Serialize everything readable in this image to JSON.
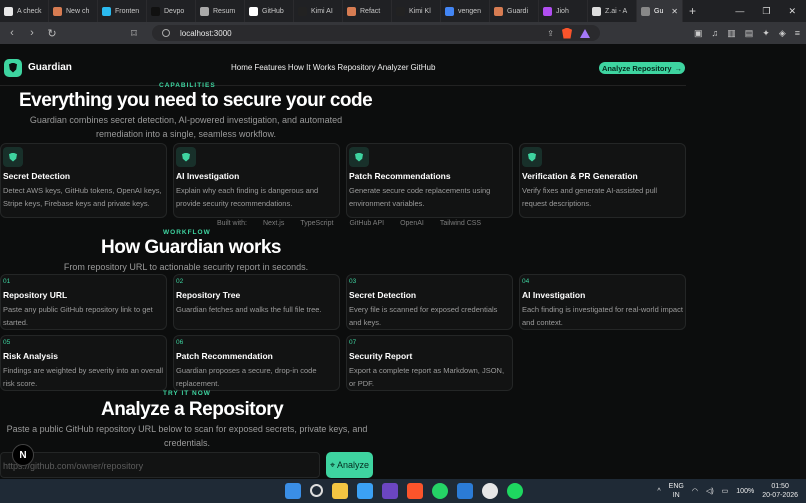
{
  "browser": {
    "tabs": [
      {
        "label": "A check",
        "color": "#e8e8e8"
      },
      {
        "label": "New ch",
        "color": "#d77c52"
      },
      {
        "label": "Fronten",
        "color": "#2bbbf0"
      },
      {
        "label": "Devpo",
        "color": "#111111"
      },
      {
        "label": "Resum",
        "color": "#aaaaaa"
      },
      {
        "label": "GitHub",
        "color": "#ffffff"
      },
      {
        "label": "Kimi AI",
        "color": "#222222"
      },
      {
        "label": "Refact",
        "color": "#d77c52"
      },
      {
        "label": "Kimi Kl",
        "color": "#222222"
      },
      {
        "label": "vengen",
        "color": "#4285f4"
      },
      {
        "label": "Guardi",
        "color": "#d77c52"
      },
      {
        "label": "Jioh",
        "color": "#b04ef0"
      },
      {
        "label": "Z.ai - A",
        "color": "#dddddd"
      },
      {
        "label": "Gu",
        "color": "#888888",
        "active": true
      }
    ],
    "url": "localhost:3000"
  },
  "site": {
    "brand": "Guardian",
    "nav": [
      "Home",
      "Features",
      "How It Works",
      "Repository Analyzer",
      "GitHub"
    ],
    "cta": "Analyze Repository",
    "cta_arrow": "→"
  },
  "capabilities": {
    "eyebrow": "CAPABILITIES",
    "title": "Everything you need to secure your code",
    "subtitle": "Guardian combines secret detection, AI-powered investigation, and automated remediation into a single, seamless workflow.",
    "cards": [
      {
        "title": "Secret Detection",
        "desc": "Detect AWS keys, GitHub tokens, OpenAI keys, Stripe keys, Firebase keys and private keys."
      },
      {
        "title": "AI Investigation",
        "desc": "Explain why each finding is dangerous and provide security recommendations."
      },
      {
        "title": "Patch Recommendations",
        "desc": "Generate secure code replacements using environment variables."
      },
      {
        "title": "Verification & PR Generation",
        "desc": "Verify fixes and generate AI-assisted pull request descriptions."
      }
    ]
  },
  "built_with": {
    "label": "Built with:",
    "items": [
      "Next.js",
      "TypeScript",
      "GitHub API",
      "OpenAI",
      "Tailwind CSS"
    ]
  },
  "workflow": {
    "eyebrow": "WORKFLOW",
    "title": "How Guardian works",
    "subtitle": "From repository URL to actionable security report in seconds.",
    "steps": [
      {
        "num": "01",
        "title": "Repository URL",
        "desc": "Paste any public GitHub repository link to get started."
      },
      {
        "num": "02",
        "title": "Repository Tree",
        "desc": "Guardian fetches and walks the full file tree."
      },
      {
        "num": "03",
        "title": "Secret Detection",
        "desc": "Every file is scanned for exposed credentials and keys."
      },
      {
        "num": "04",
        "title": "AI Investigation",
        "desc": "Each finding is investigated for real-world impact and context."
      },
      {
        "num": "05",
        "title": "Risk Analysis",
        "desc": "Findings are weighted by severity into an overall risk score."
      },
      {
        "num": "06",
        "title": "Patch Recommendation",
        "desc": "Guardian proposes a secure, drop-in code replacement."
      },
      {
        "num": "07",
        "title": "Security Report",
        "desc": "Export a complete report as Markdown, JSON, or PDF."
      }
    ]
  },
  "try": {
    "eyebrow": "TRY IT NOW",
    "title": "Analyze a Repository",
    "subtitle": "Paste a public GitHub repository URL below to scan for exposed secrets, private keys, and credentials.",
    "placeholder": "https://github.com/owner/repository",
    "button": "Analyze"
  },
  "taskbar": {
    "lang_top": "ENG",
    "lang_bottom": "IN",
    "battery": "100%",
    "time": "01:50",
    "date": "20-07-2026"
  }
}
